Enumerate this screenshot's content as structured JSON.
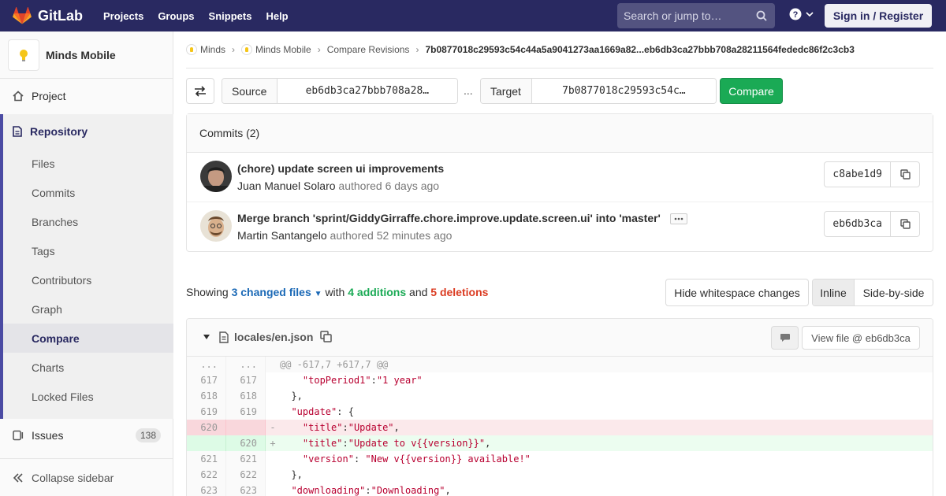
{
  "navbar": {
    "brand": "GitLab",
    "links": [
      "Projects",
      "Groups",
      "Snippets",
      "Help"
    ],
    "search_placeholder": "Search or jump to…",
    "signin_label": "Sign in / Register",
    "bg_color": "#292961"
  },
  "sidebar": {
    "project_name": "Minds Mobile",
    "project_label": "Project",
    "repository_label": "Repository",
    "items": [
      "Files",
      "Commits",
      "Branches",
      "Tags",
      "Contributors",
      "Graph",
      "Compare",
      "Charts",
      "Locked Files"
    ],
    "active_item": "Compare",
    "issues_label": "Issues",
    "issues_count": "138",
    "collapse_label": "Collapse sidebar"
  },
  "breadcrumb": {
    "items": [
      "Minds",
      "Minds Mobile",
      "Compare Revisions"
    ],
    "current": "7b0877018c29593c54c44a5a9041273aa1669a82...eb6db3ca27bbb708a28211564fededc86f2c3cb3"
  },
  "compare": {
    "source_label": "Source",
    "source_value": "eb6db3ca27bbb708a28…",
    "separator": "...",
    "target_label": "Target",
    "target_value": "7b0877018c29593c54c…",
    "compare_label": "Compare"
  },
  "commits": {
    "header": "Commits (2)",
    "items": [
      {
        "title": "(chore) update screen ui improvements",
        "author": "Juan Manuel Solaro",
        "authored": "authored",
        "when": "6 days ago",
        "sha": "c8abe1d9"
      },
      {
        "title": "Merge branch 'sprint/GiddyGirraffe.chore.improve.update.screen.ui' into 'master'",
        "author": "Martin Santangelo",
        "authored": "authored",
        "when": "52 minutes ago",
        "sha": "eb6db3ca"
      }
    ]
  },
  "stats": {
    "showing": "Showing",
    "changed_files": "3 changed files",
    "with": "with",
    "additions": "4 additions",
    "and": "and",
    "deletions": "5 deletions",
    "whitespace_label": "Hide whitespace changes",
    "inline_label": "Inline",
    "side_by_side_label": "Side-by-side"
  },
  "file": {
    "path": "locales/en.json",
    "view_file_label": "View file @ eb6db3ca",
    "lines": [
      {
        "type": "match",
        "old": "...",
        "new": "...",
        "sign": "",
        "code": "@@ -617,7 +617,7 @@"
      },
      {
        "type": "context",
        "old": "617",
        "new": "617",
        "sign": "",
        "code": "    \"topPeriod1\":\"1 year\""
      },
      {
        "type": "context",
        "old": "618",
        "new": "618",
        "sign": "",
        "code": "  },"
      },
      {
        "type": "context",
        "old": "619",
        "new": "619",
        "sign": "",
        "code": "  \"update\": {"
      },
      {
        "type": "old",
        "old": "620",
        "new": "",
        "sign": "-",
        "code": "    \"title\":\"Update\","
      },
      {
        "type": "new",
        "old": "",
        "new": "620",
        "sign": "+",
        "code": "    \"title\":\"Update to v{{version}}\","
      },
      {
        "type": "context",
        "old": "621",
        "new": "621",
        "sign": "",
        "code": "    \"version\": \"New v{{version}} available!\""
      },
      {
        "type": "context",
        "old": "622",
        "new": "622",
        "sign": "",
        "code": "  },"
      },
      {
        "type": "context",
        "old": "623",
        "new": "623",
        "sign": "",
        "code": "  \"downloading\":\"Downloading\","
      }
    ]
  }
}
